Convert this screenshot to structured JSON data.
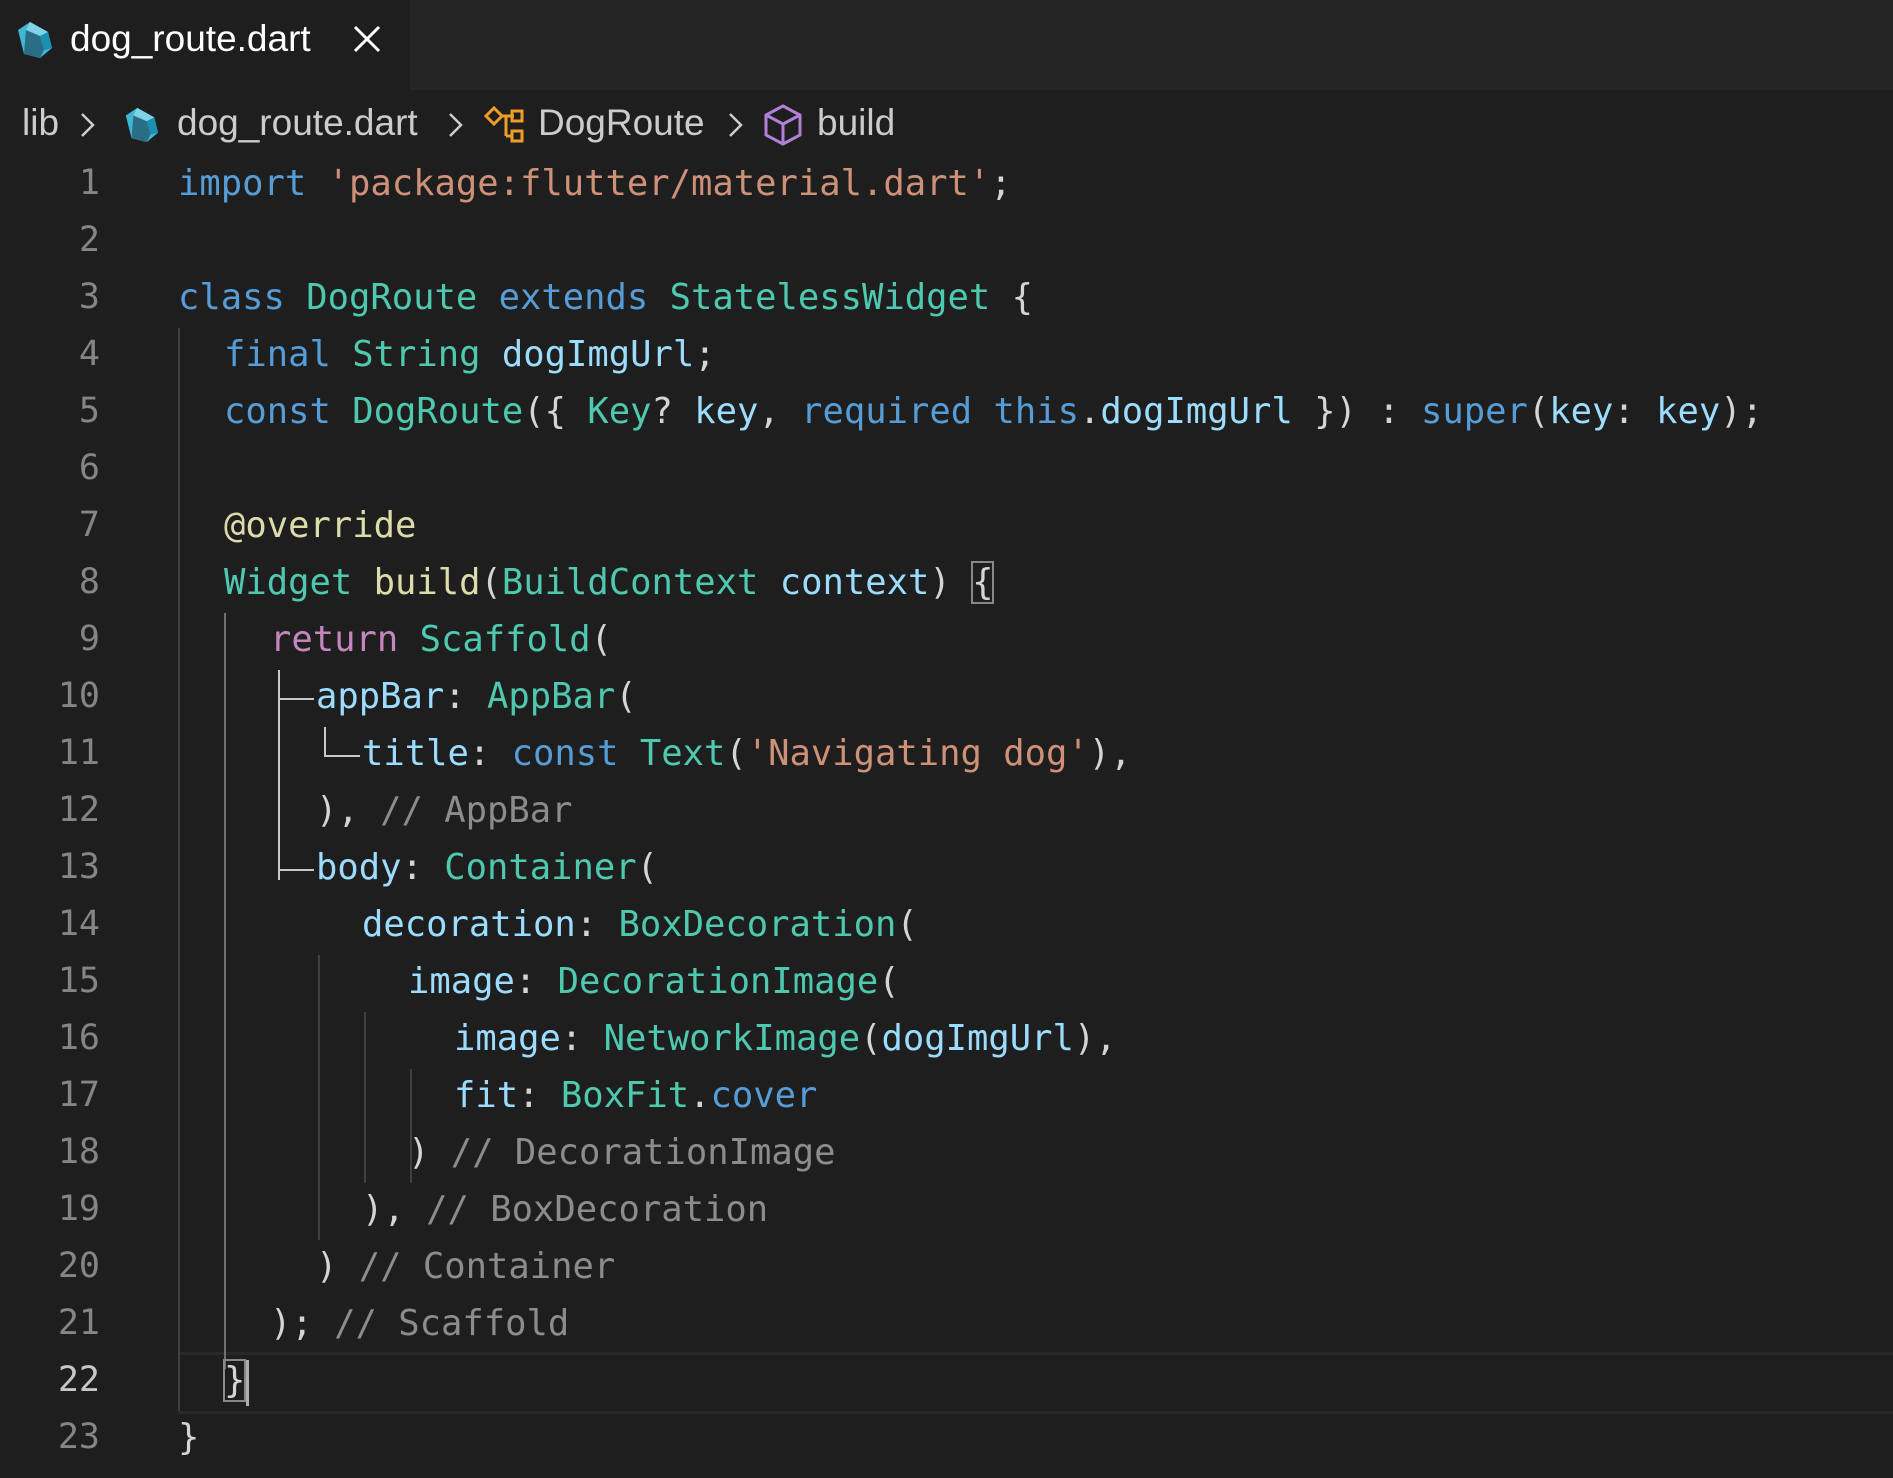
{
  "tab": {
    "file_name": "dog_route.dart",
    "icon": "dart-icon"
  },
  "breadcrumb": {
    "folder": "lib",
    "file": "dog_route.dart",
    "class_name": "DogRoute",
    "method": "build",
    "icons": [
      "chevron-right-icon",
      "dart-icon",
      "class-icon",
      "method-cube-icon"
    ]
  },
  "editor": {
    "active_line": 22,
    "line_numbers": [
      "1",
      "2",
      "3",
      "4",
      "5",
      "6",
      "7",
      "8",
      "9",
      "10",
      "11",
      "12",
      "13",
      "14",
      "15",
      "16",
      "17",
      "18",
      "19",
      "20",
      "21",
      "22",
      "23"
    ],
    "lines": {
      "l1": {
        "t1": "import",
        "t2": " ",
        "t3": "'package:flutter/material.dart'",
        "t4": ";"
      },
      "l3": {
        "t1": "class",
        "t2": " ",
        "t3": "DogRoute",
        "t4": " ",
        "t5": "extends",
        "t6": " ",
        "t7": "StatelessWidget",
        "t8": " {"
      },
      "l4": {
        "t1": "final",
        "t2": " ",
        "t3": "String",
        "t4": " ",
        "t5": "dogImgUrl",
        "t6": ";"
      },
      "l5": {
        "t1": "const",
        "t2": " ",
        "t3": "DogRoute",
        "t4": "({ ",
        "t5": "Key",
        "t6": "? ",
        "t7": "key",
        "t8": ", ",
        "t9": "required",
        "t10": " ",
        "t11": "this",
        "t12": ".",
        "t13": "dogImgUrl",
        "t14": " }) : ",
        "t15": "super",
        "t16": "(",
        "t17": "key",
        "t18": ": ",
        "t19": "key",
        "t20": ");"
      },
      "l7": {
        "t1": "@override"
      },
      "l8": {
        "t1": "Widget",
        "t2": " ",
        "t3": "build",
        "t4": "(",
        "t5": "BuildContext",
        "t6": " ",
        "t7": "context",
        "t8": ") ",
        "t9": "{"
      },
      "l9": {
        "t1": "return",
        "t2": " ",
        "t3": "Scaffold",
        "t4": "("
      },
      "l10": {
        "t1": "appBar",
        "t2": ": ",
        "t3": "AppBar",
        "t4": "("
      },
      "l11": {
        "t1": "title",
        "t2": ": ",
        "t3": "const",
        "t4": " ",
        "t5": "Text",
        "t6": "(",
        "t7": "'Navigating dog'",
        "t8": "),"
      },
      "l12": {
        "t1": "),",
        "t2": " ",
        "t3": "// AppBar"
      },
      "l13": {
        "t1": "body",
        "t2": ": ",
        "t3": "Container",
        "t4": "("
      },
      "l14": {
        "t1": "decoration",
        "t2": ": ",
        "t3": "BoxDecoration",
        "t4": "("
      },
      "l15": {
        "t1": "image",
        "t2": ": ",
        "t3": "DecorationImage",
        "t4": "("
      },
      "l16": {
        "t1": "image",
        "t2": ": ",
        "t3": "NetworkImage",
        "t4": "(",
        "t5": "dogImgUrl",
        "t6": "),"
      },
      "l17": {
        "t1": "fit",
        "t2": ": ",
        "t3": "BoxFit",
        "t4": ".",
        "t5": "cover"
      },
      "l18": {
        "t1": ")",
        "t2": " ",
        "t3": "// DecorationImage"
      },
      "l19": {
        "t1": "),",
        "t2": " ",
        "t3": "// BoxDecoration"
      },
      "l20": {
        "t1": ")",
        "t2": " ",
        "t3": "// Container"
      },
      "l21": {
        "t1": ");",
        "t2": " ",
        "t3": "// Scaffold"
      },
      "l22": {
        "t1": "}"
      },
      "l23": {
        "t1": "}"
      }
    }
  },
  "colors": {
    "background": "#1e1e1e",
    "tab_bar": "#252526",
    "keyword": "#569cd6",
    "control_keyword": "#c586c0",
    "type": "#4ec9b0",
    "string": "#ce9178",
    "variable": "#9cdcfe",
    "function": "#dcdcaa",
    "comment": "#8c8c8c",
    "line_number": "#858585"
  }
}
